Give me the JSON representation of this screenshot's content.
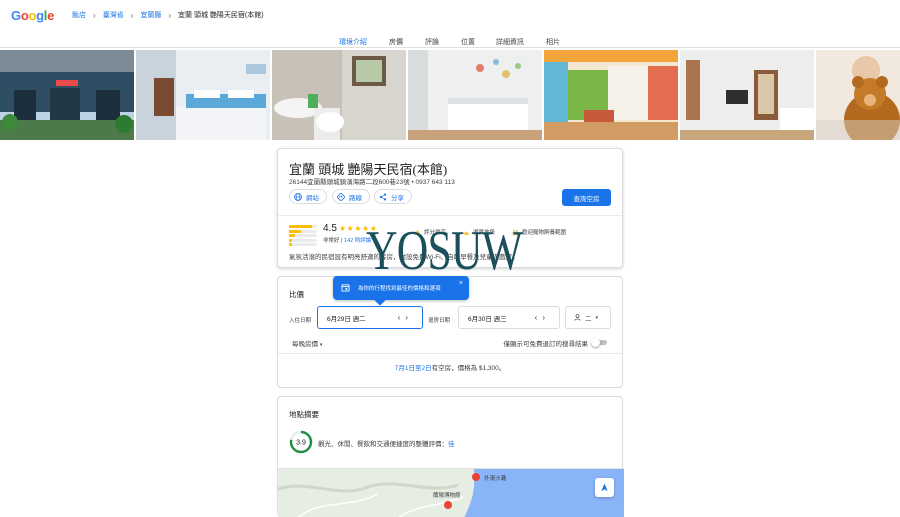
{
  "header": {
    "logo_letters": [
      {
        "ch": "G",
        "color": "#4285f4"
      },
      {
        "ch": "o",
        "color": "#ea4335"
      },
      {
        "ch": "o",
        "color": "#fbbc05"
      },
      {
        "ch": "g",
        "color": "#4285f4"
      },
      {
        "ch": "l",
        "color": "#34a853"
      },
      {
        "ch": "e",
        "color": "#ea4335"
      }
    ],
    "breadcrumbs": [
      {
        "label": "飯店"
      },
      {
        "label": "臺灣省"
      },
      {
        "label": "宜蘭縣"
      }
    ],
    "breadcrumb_current": "宜蘭 頭城 艷陽天民宿(本館)"
  },
  "tabs": [
    {
      "label": "環境介紹",
      "active": true
    },
    {
      "label": "房價",
      "active": false
    },
    {
      "label": "評論",
      "active": false
    },
    {
      "label": "位置",
      "active": false
    },
    {
      "label": "詳細資訊",
      "active": false
    },
    {
      "label": "相片",
      "active": false
    }
  ],
  "hotel": {
    "name": "宜蘭 頭城 艷陽天民宿(本館)",
    "address": "26144宜蘭縣頭城鎮濱海路二段600巷23號 • 0937 643 113",
    "actions": [
      {
        "label": "網站",
        "icon": "globe-icon"
      },
      {
        "label": "路線",
        "icon": "directions-icon"
      },
      {
        "label": "分享",
        "icon": "share-icon"
      }
    ],
    "check_availability_label": "查詢空房",
    "rating": "4.5",
    "stars": "★★★★★",
    "rating_breakdown": [
      0.82,
      0.42,
      0.22,
      0.12,
      0.1
    ],
    "rating_label": "非常好",
    "review_count": "142 則評論",
    "features": [
      {
        "label": "評分最高",
        "icon": "star-outline-icon"
      },
      {
        "label": "湖景地段",
        "icon": "lake-icon"
      },
      {
        "label": "歡迎寵物飼養範圍",
        "icon": "pet-icon"
      }
    ],
    "description": "氣氛活潑的民宿設有明亮舒適的客房，附設免費Wi-Fi、自助早餐及兒童遊戲室。"
  },
  "pricing": {
    "title": "比價",
    "tooltip": "為你的行程找到最佳的價格和選項",
    "checkin_label": "入住日期",
    "checkin_value": "6月29日 週二",
    "checkout_label": "退房日期",
    "checkout_value": "6月30日 週三",
    "guests_value": "二",
    "nightly_label": "每晚房價",
    "toggle_label": "僅顯示可免費退訂的搜尋結果",
    "availability_link": "7月1日至2日",
    "availability_text": "有空房，價格為 $1,300。"
  },
  "location": {
    "title": "地點摘要",
    "score": "3.9",
    "score_fraction": 0.78,
    "score_desc": "觀光、休閒、餐飲和交通便捷度的整體評價：",
    "score_link": "佳",
    "map_labels": [
      "外澳沙灘",
      "蘭陽博物館"
    ]
  },
  "watermark": "YOSUW",
  "colors": {
    "accent": "#1a73e8",
    "star": "#fbbc04",
    "score_ring": "#1e8e3e"
  }
}
